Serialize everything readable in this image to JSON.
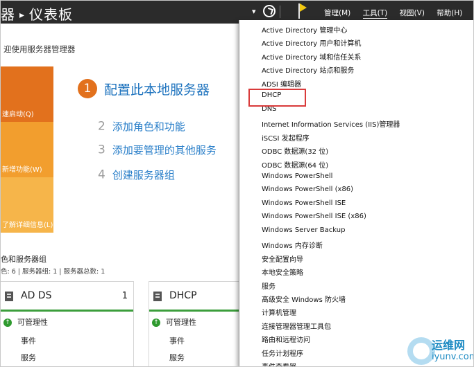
{
  "titlebar": {
    "breadcrumb_left": "器",
    "breadcrumb_sep": "▸",
    "breadcrumb_title": "仪表板",
    "menus": [
      "管理(M)",
      "工具(T)",
      "视图(V)",
      "帮助(H)"
    ],
    "active_menu_index": 1
  },
  "welcome": {
    "heading": "迎使用服务器管理器",
    "tiles": [
      "速启动(Q)",
      "新增功能(W)",
      "了解详细信息(L)"
    ],
    "steps": [
      {
        "num": "1",
        "label": "配置此本地服务器"
      },
      {
        "num": "2",
        "label": "添加角色和功能"
      },
      {
        "num": "3",
        "label": "添加要管理的其他服务"
      },
      {
        "num": "4",
        "label": "创建服务器组"
      }
    ]
  },
  "roles": {
    "title": "色和服务器组",
    "stats": "色: 6 | 服务器组: 1 | 服务器总数: 1",
    "cards": [
      {
        "name": "AD DS",
        "count": "1",
        "status": "可管理性",
        "rows": [
          "事件",
          "服务"
        ]
      },
      {
        "name": "DHCP",
        "count": "",
        "status": "可管理性",
        "rows": [
          "事件",
          "服务"
        ]
      }
    ]
  },
  "tools_menu": {
    "items": [
      "Active Directory 管理中心",
      "Active Directory 用户和计算机",
      "Active Directory 域和信任关系",
      "Active Directory 站点和服务",
      "ADSI 编辑器",
      "DHCP",
      "DNS",
      "Internet Information Services (IIS)管理器",
      "iSCSI 发起程序",
      "ODBC 数据源(32 位)",
      "ODBC 数据源(64 位)",
      "Windows PowerShell",
      "Windows PowerShell (x86)",
      "Windows PowerShell ISE",
      "Windows PowerShell ISE (x86)",
      "Windows Server Backup",
      "Windows 内存诊断",
      "安全配置向导",
      "本地安全策略",
      "服务",
      "高级安全 Windows 防火墙",
      "计算机管理",
      "连接管理器管理工具包",
      "路由和远程访问",
      "任务计划程序",
      "事件查看器"
    ],
    "highlighted_item": "DHCP",
    "highlight_color": "#d93a3a"
  },
  "watermark": {
    "cn": "运维网",
    "en": "iyunv.com"
  },
  "colors": {
    "titlebar_bg": "#2b2b2b",
    "accent_orange": "#e2711d",
    "link_blue": "#2a7fc9",
    "status_green": "#3c9e3c"
  }
}
